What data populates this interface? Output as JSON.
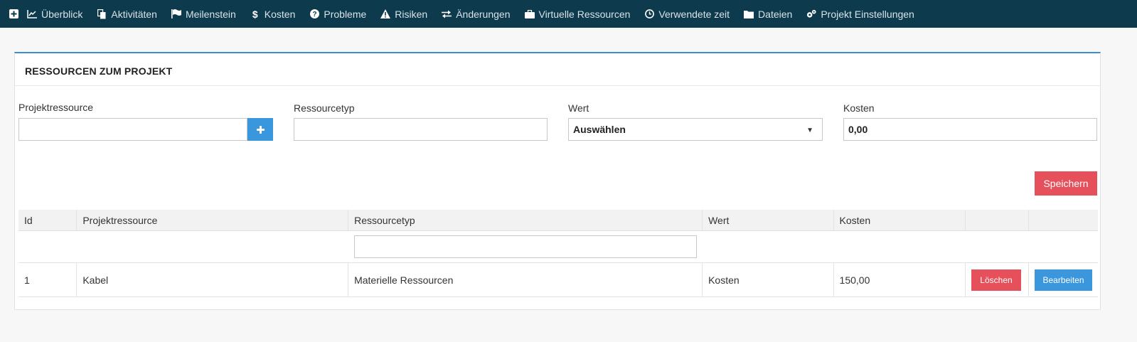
{
  "nav": {
    "add_icon": "plus-square-icon",
    "items": [
      {
        "label": "Überblick",
        "icon": "line-chart-icon"
      },
      {
        "label": "Aktivitäten",
        "icon": "copy-icon"
      },
      {
        "label": "Meilenstein",
        "icon": "flag-icon"
      },
      {
        "label": "Kosten",
        "icon": "dollar-icon"
      },
      {
        "label": "Probleme",
        "icon": "question-circle-icon"
      },
      {
        "label": "Risiken",
        "icon": "warning-icon"
      },
      {
        "label": "Änderungen",
        "icon": "exchange-icon"
      },
      {
        "label": "Virtuelle Ressourcen",
        "icon": "briefcase-icon"
      },
      {
        "label": "Verwendete zeit",
        "icon": "clock-icon"
      },
      {
        "label": "Dateien",
        "icon": "folder-icon"
      },
      {
        "label": "Projekt Einstellungen",
        "icon": "gears-icon"
      }
    ]
  },
  "panel": {
    "title": "RESSOURCEN ZUM PROJEKT"
  },
  "form": {
    "projektressource_label": "Projektressource",
    "projektressource_value": "",
    "ressourcetyp_label": "Ressourcetyp",
    "ressourcetyp_value": "",
    "wert_label": "Wert",
    "wert_selected": "Auswählen",
    "kosten_label": "Kosten",
    "kosten_value": "0,00",
    "save_label": "Speichern"
  },
  "table": {
    "headers": [
      "Id",
      "Projektressource",
      "Ressourcetyp",
      "Wert",
      "Kosten",
      "",
      ""
    ],
    "filter_value": "",
    "rows": [
      {
        "id": "1",
        "projektressource": "Kabel",
        "ressourcetyp": "Materielle Ressourcen",
        "wert": "Kosten",
        "kosten": "150,00",
        "delete_label": "Löschen",
        "edit_label": "Bearbeiten"
      }
    ]
  },
  "colors": {
    "nav_bg": "#0d3a4d",
    "accent_blue": "#3a96dd",
    "danger_red": "#e5505a"
  }
}
